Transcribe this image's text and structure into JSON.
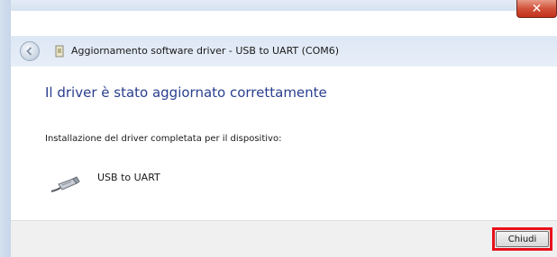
{
  "window": {
    "title": "Aggiornamento software driver - USB to UART (COM6)",
    "close_glyph": "✕"
  },
  "content": {
    "heading": "Il driver è stato aggiornato correttamente",
    "description": "Installazione del driver completata per il dispositivo:",
    "device_name": "USB to UART"
  },
  "footer": {
    "close_label": "Chiudi"
  },
  "icons": {
    "back": "back-arrow-icon",
    "title": "device-driver-icon",
    "device": "usb-cable-icon"
  },
  "colors": {
    "heading": "#2a3f8f",
    "close_button": "#c2301a",
    "highlight": "#e8101a"
  }
}
